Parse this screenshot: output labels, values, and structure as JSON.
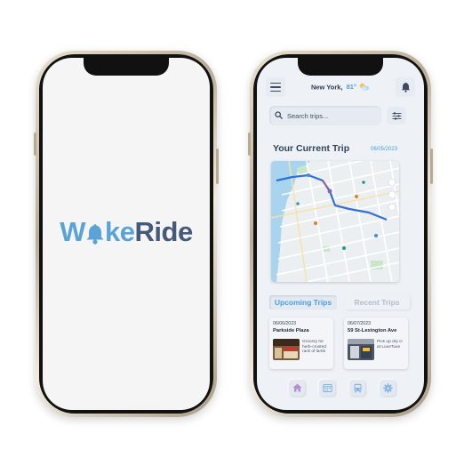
{
  "splash": {
    "logo_part1": "W",
    "logo_part2": "ke",
    "logo_part3": "Ride",
    "logo_bell_icon": "bell-icon"
  },
  "app": {
    "header": {
      "menu_icon": "hamburger-menu-icon",
      "location": "New York,",
      "temperature": "81°",
      "weather_icon": "partly-cloudy-icon",
      "notification_icon": "bell-icon"
    },
    "search": {
      "placeholder": "Search trips...",
      "search_icon": "search-icon",
      "filter_icon": "sliders-filter-icon"
    },
    "current_trip": {
      "title": "Your Current Trip",
      "date": "06/05/2023"
    },
    "tabs": [
      {
        "label": "Upcoming Trips",
        "active": true
      },
      {
        "label": "Recent Trips",
        "active": false
      }
    ],
    "trips": [
      {
        "date": "06/06/2023",
        "name": "Parkside Plaza",
        "description": "Grocery for herb-crusted rack of lamb"
      },
      {
        "date": "06/07/2023",
        "name": "59 St-Lexington Ave",
        "description": "Pick up dry cl at LuxeTuxe"
      }
    ],
    "bottom_nav": [
      {
        "icon": "home-icon",
        "active": true
      },
      {
        "icon": "calendar-icon",
        "active": false
      },
      {
        "icon": "bus-icon",
        "active": false
      },
      {
        "icon": "settings-gear-icon",
        "active": false
      }
    ]
  },
  "colors": {
    "accent_blue": "#5aa3d6",
    "logo_dark": "#455a7a",
    "nav_active": "#b58fd1",
    "screen_bg": "#eef1f6"
  }
}
